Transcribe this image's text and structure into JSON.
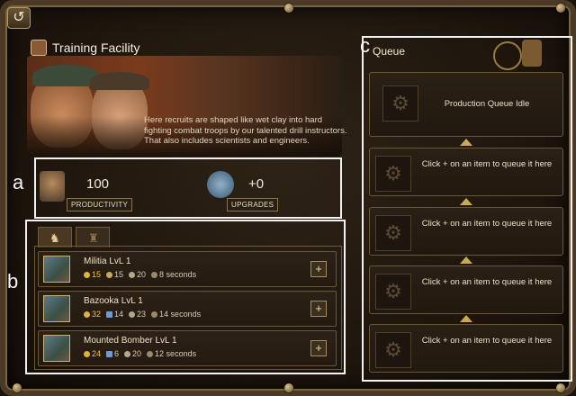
{
  "window": {
    "title": "Training Facility",
    "description": "Here recruits are shaped like wet clay into hard fighting combat troops by our talented drill instructors. That also includes scientists and engineers.",
    "back_symbol": "↺"
  },
  "annotations": {
    "a": "a",
    "b": "b",
    "c": "c"
  },
  "stats": {
    "productivity_value": "100",
    "productivity_label": "PRODUCTIVITY",
    "upgrades_value": "+0",
    "upgrades_label": "UPGRADES"
  },
  "tabs": [
    {
      "icon": "infantry-icon",
      "active": true
    },
    {
      "icon": "soldier-silhouette-icon",
      "active": false
    }
  ],
  "units": [
    {
      "name": "Militia LvL 1",
      "gold": "15",
      "ammo": "",
      "men": "20",
      "time": "8 seconds"
    },
    {
      "name": "Bazooka LvL 1",
      "gold": "32",
      "ammo": "14",
      "men": "23",
      "time": "14 seconds"
    },
    {
      "name": "Mounted Bomber LvL 1",
      "gold": "24",
      "ammo": "6",
      "men": "20",
      "time": "12 seconds"
    }
  ],
  "units_first_row_second_value": "15",
  "queue": {
    "title": "Queue",
    "idle_text": "Production Queue Idle",
    "slot_text": "Click + on an item to queue it here",
    "plus_symbol": "+"
  },
  "colors": {
    "accent_gold": "#c9a858",
    "annotation_white": "#f2f2f2"
  }
}
